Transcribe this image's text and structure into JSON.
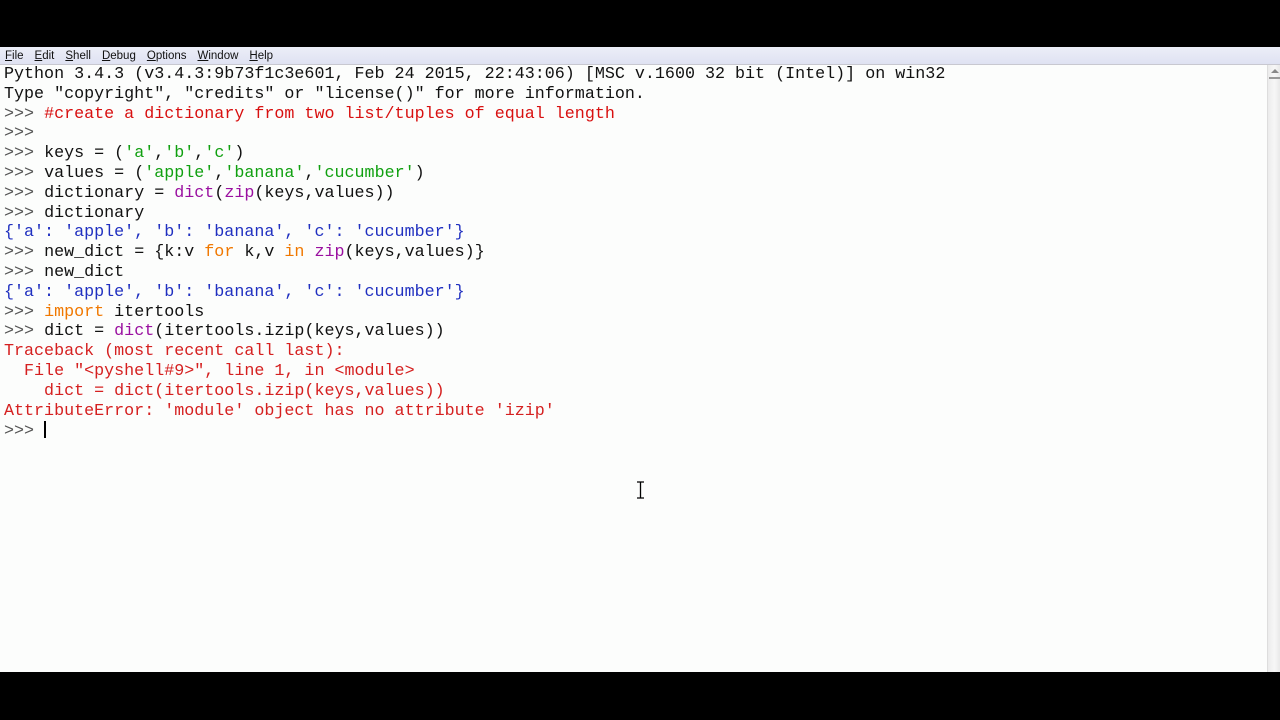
{
  "menu": [
    "File",
    "Edit",
    "Shell",
    "Debug",
    "Options",
    "Window",
    "Help"
  ],
  "colors": {
    "prompt": "#555555",
    "comment": "#d81010",
    "string": "#10a010",
    "builtin": "#9a10a0",
    "keyword": "#f07800",
    "output": "#2030c0",
    "error": "#d52020"
  },
  "lines": [
    [
      {
        "t": "Python 3.4.3 (v3.4.3:9b73f1c3e601, Feb 24 2015, 22:43:06) [MSC v.1600 32 bit (Intel)] on win32",
        "c": "plain"
      }
    ],
    [
      {
        "t": "Type \"copyright\", \"credits\" or \"license()\" for more information.",
        "c": "plain"
      }
    ],
    [
      {
        "t": ">>> ",
        "c": "prompt"
      },
      {
        "t": "#create a dictionary from two list/tuples of equal length",
        "c": "comment"
      }
    ],
    [
      {
        "t": ">>> ",
        "c": "prompt"
      }
    ],
    [
      {
        "t": ">>> ",
        "c": "prompt"
      },
      {
        "t": "keys = (",
        "c": "plain"
      },
      {
        "t": "'a'",
        "c": "string"
      },
      {
        "t": ",",
        "c": "plain"
      },
      {
        "t": "'b'",
        "c": "string"
      },
      {
        "t": ",",
        "c": "plain"
      },
      {
        "t": "'c'",
        "c": "string"
      },
      {
        "t": ")",
        "c": "plain"
      }
    ],
    [
      {
        "t": ">>> ",
        "c": "prompt"
      },
      {
        "t": "values = (",
        "c": "plain"
      },
      {
        "t": "'apple'",
        "c": "string"
      },
      {
        "t": ",",
        "c": "plain"
      },
      {
        "t": "'banana'",
        "c": "string"
      },
      {
        "t": ",",
        "c": "plain"
      },
      {
        "t": "'cucumber'",
        "c": "string"
      },
      {
        "t": ")",
        "c": "plain"
      }
    ],
    [
      {
        "t": ">>> ",
        "c": "prompt"
      },
      {
        "t": "dictionary = ",
        "c": "plain"
      },
      {
        "t": "dict",
        "c": "builtin"
      },
      {
        "t": "(",
        "c": "plain"
      },
      {
        "t": "zip",
        "c": "builtin"
      },
      {
        "t": "(keys,values))",
        "c": "plain"
      }
    ],
    [
      {
        "t": ">>> ",
        "c": "prompt"
      },
      {
        "t": "dictionary",
        "c": "plain"
      }
    ],
    [
      {
        "t": "{'a': 'apple', 'b': 'banana', 'c': 'cucumber'}",
        "c": "output"
      }
    ],
    [
      {
        "t": ">>> ",
        "c": "prompt"
      },
      {
        "t": "new_dict = {k:v ",
        "c": "plain"
      },
      {
        "t": "for",
        "c": "keyword"
      },
      {
        "t": " k,v ",
        "c": "plain"
      },
      {
        "t": "in",
        "c": "keyword"
      },
      {
        "t": " ",
        "c": "plain"
      },
      {
        "t": "zip",
        "c": "builtin"
      },
      {
        "t": "(keys,values)}",
        "c": "plain"
      }
    ],
    [
      {
        "t": ">>> ",
        "c": "prompt"
      },
      {
        "t": "new_dict",
        "c": "plain"
      }
    ],
    [
      {
        "t": "{'a': 'apple', 'b': 'banana', 'c': 'cucumber'}",
        "c": "output"
      }
    ],
    [
      {
        "t": ">>> ",
        "c": "prompt"
      },
      {
        "t": "import",
        "c": "keyword"
      },
      {
        "t": " itertools",
        "c": "plain"
      }
    ],
    [
      {
        "t": ">>> ",
        "c": "prompt"
      },
      {
        "t": "dict = ",
        "c": "plain"
      },
      {
        "t": "dict",
        "c": "builtin"
      },
      {
        "t": "(itertools.izip(keys,values))",
        "c": "plain"
      }
    ],
    [
      {
        "t": "Traceback (most recent call last):",
        "c": "error"
      }
    ],
    [
      {
        "t": "  File \"<pyshell#9>\", line 1, in <module>",
        "c": "error"
      }
    ],
    [
      {
        "t": "    dict = dict(itertools.izip(keys,values))",
        "c": "error"
      }
    ],
    [
      {
        "t": "AttributeError: 'module' object has no attribute 'izip'",
        "c": "error"
      }
    ],
    [
      {
        "t": ">>> ",
        "c": "prompt"
      }
    ]
  ]
}
